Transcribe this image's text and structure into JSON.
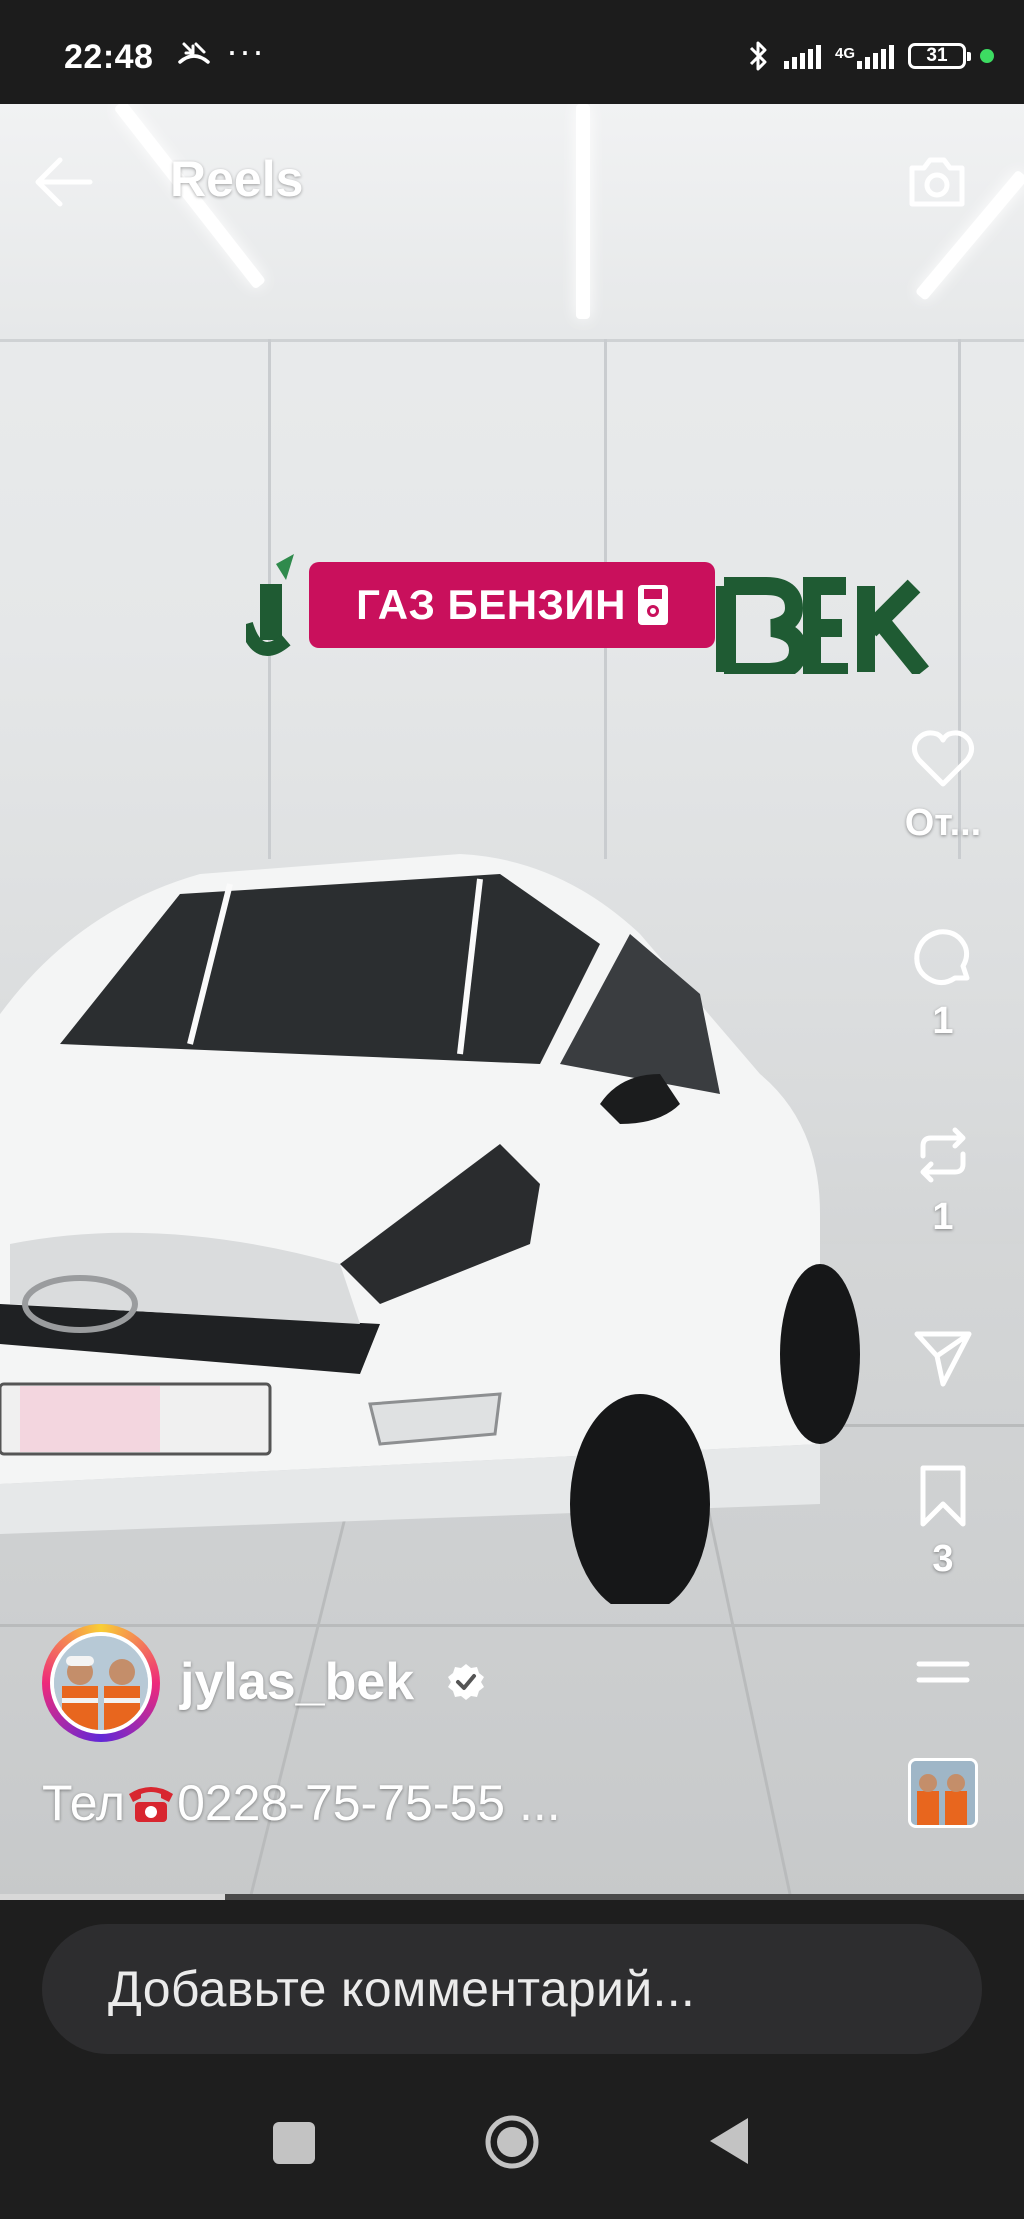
{
  "status_bar": {
    "time": "22:48",
    "dots": "···",
    "network": "4G",
    "battery": "31",
    "icons": [
      "missed-call-icon",
      "bluetooth-icon",
      "signal-icon",
      "battery-icon"
    ]
  },
  "topbar": {
    "title": "Reels",
    "icons": [
      "back-arrow-icon",
      "camera-icon"
    ]
  },
  "video": {
    "sticker_text": "ГАЗ БЕНЗИН",
    "sticker_icon": "fuel-pump-icon",
    "progress": 0.22
  },
  "rail": {
    "like_count": "От...",
    "comment_count": "1",
    "repost_count": "1",
    "save_count": "3",
    "icons": [
      "heart-icon",
      "comment-icon",
      "repost-icon",
      "send-icon",
      "bookmark-icon",
      "menu-icon"
    ]
  },
  "author": {
    "username": "jylas_bek",
    "caption": "Тел",
    "caption_phone": "0228-75-75-55",
    "caption_more": " ..."
  },
  "comment_box": {
    "placeholder": "Добавьте комментарий..."
  },
  "colors": {
    "sticker": "#c9105c",
    "logo_green": "#1f5b33",
    "panel": "#1e1e1e"
  }
}
